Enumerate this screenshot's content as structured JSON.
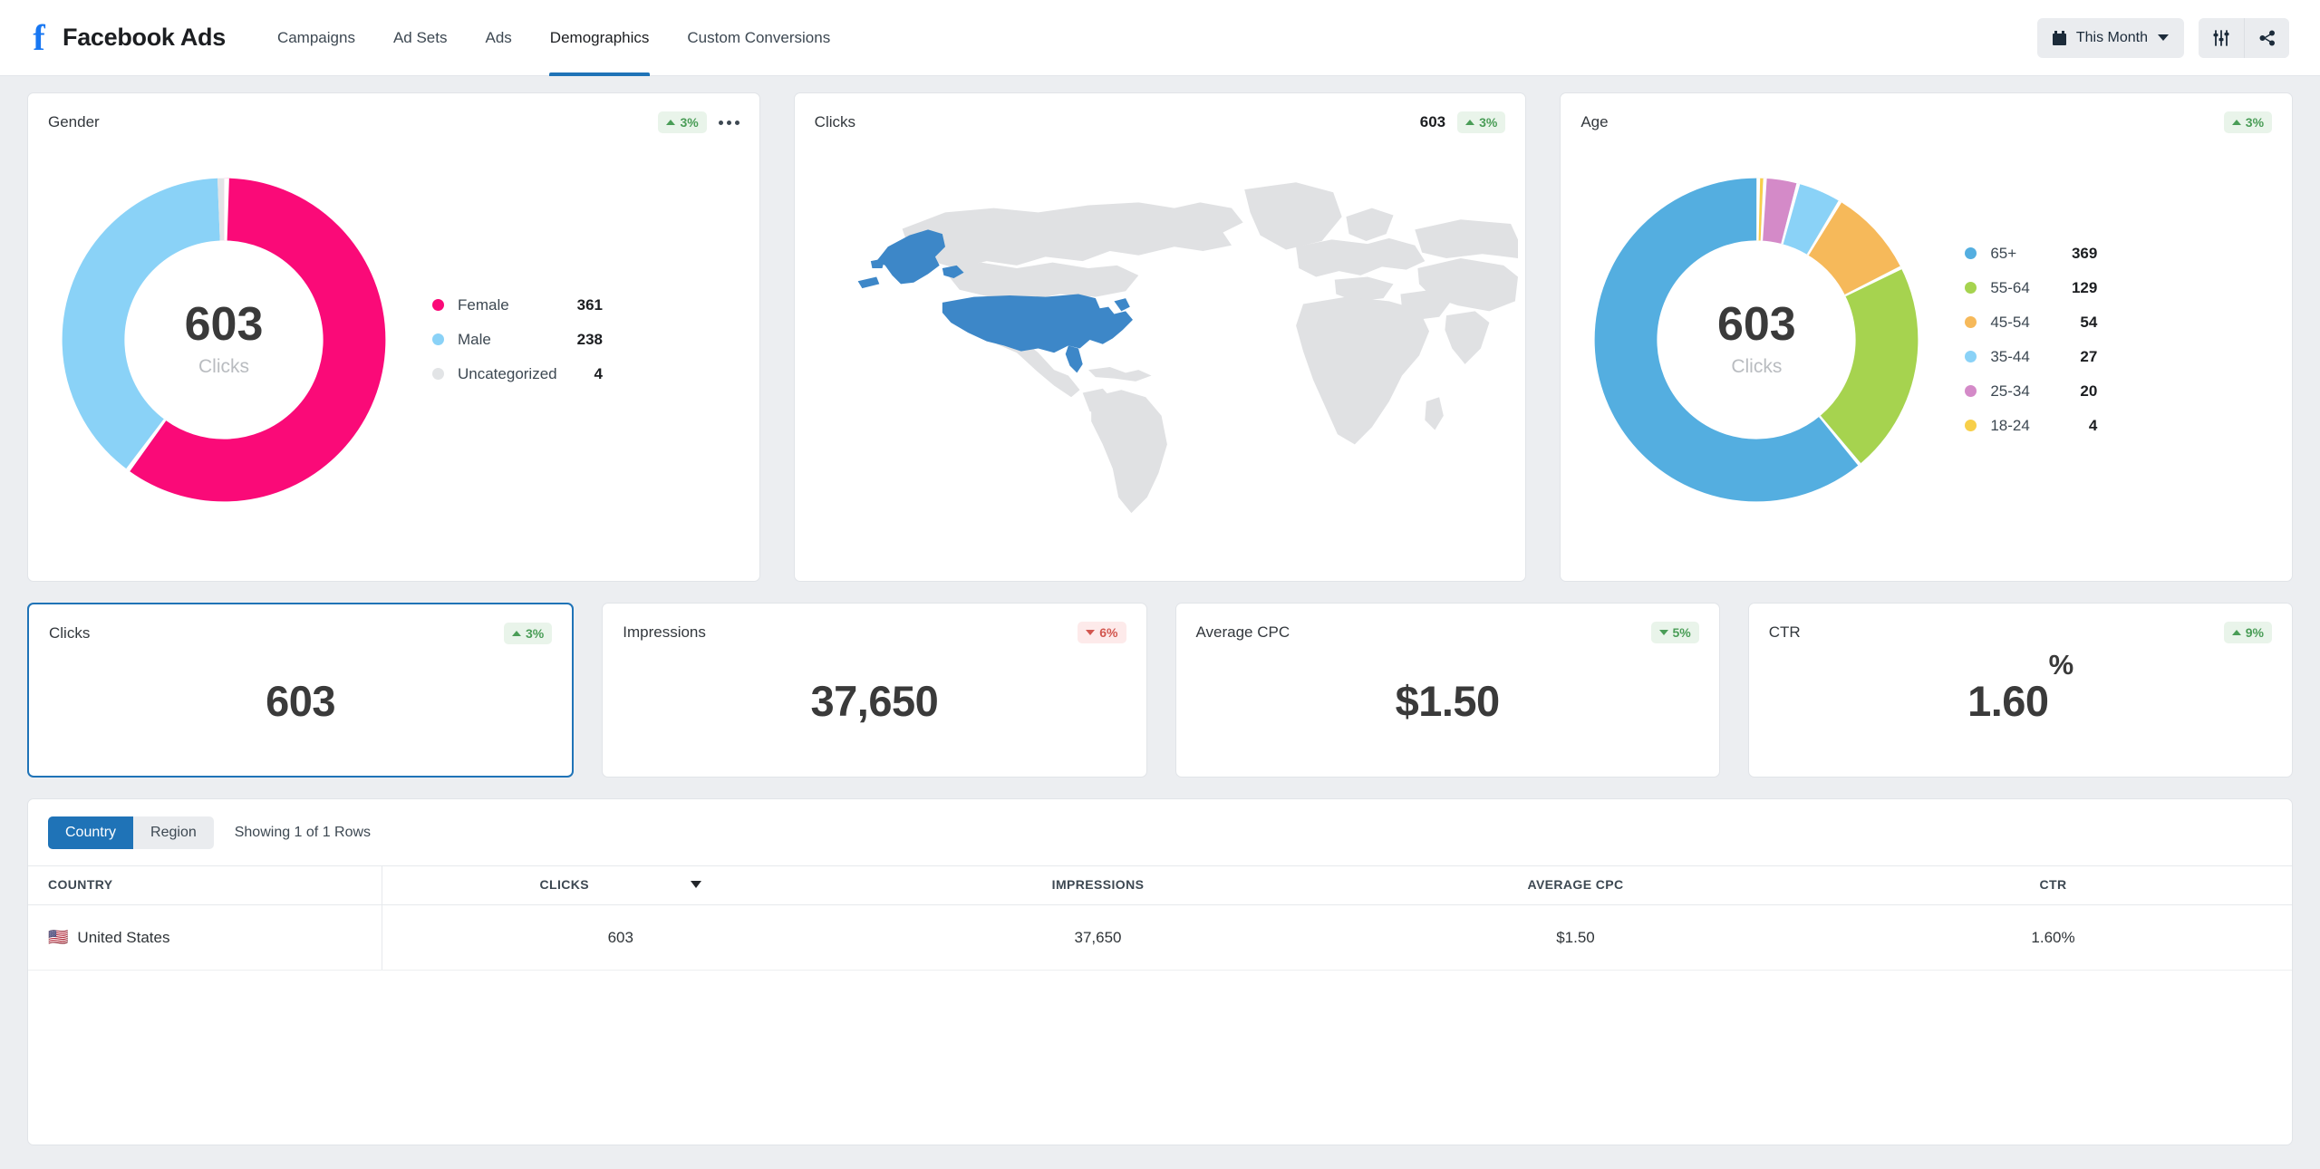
{
  "nav": {
    "brand": "Facebook Ads",
    "brand_icon": "facebook-f-icon",
    "links": [
      {
        "label": "Campaigns",
        "active": false
      },
      {
        "label": "Ad Sets",
        "active": false
      },
      {
        "label": "Ads",
        "active": false
      },
      {
        "label": "Demographics",
        "active": true
      },
      {
        "label": "Custom Conversions",
        "active": false
      }
    ],
    "date_filter": {
      "label": "This Month",
      "icon": "calendar-icon",
      "chevron": "chevron-down-icon"
    },
    "filter_icon": "sliders-icon",
    "share_icon": "share-icon",
    "accent": "#1f73b7"
  },
  "cards": {
    "gender": {
      "title": "Gender",
      "badge": {
        "value": "3%",
        "direction": "up"
      },
      "menu_icon": "more-options-icon",
      "center_value": "603",
      "center_label": "Clicks"
    },
    "map": {
      "title": "Clicks",
      "value": "603",
      "badge": {
        "value": "3%",
        "direction": "up"
      },
      "highlight_color": "#3d87c8",
      "land_color": "#e0e1e3"
    },
    "age": {
      "title": "Age",
      "badge": {
        "value": "3%",
        "direction": "up"
      },
      "center_value": "603",
      "center_label": "Clicks"
    }
  },
  "kpis": [
    {
      "title": "Clicks",
      "value": "603",
      "suffix": "",
      "badge": {
        "value": "3%",
        "direction": "up"
      },
      "selected": true
    },
    {
      "title": "Impressions",
      "value": "37,650",
      "suffix": "",
      "badge": {
        "value": "6%",
        "direction": "down"
      },
      "selected": false
    },
    {
      "title": "Average CPC",
      "value": "$1.50",
      "suffix": "",
      "badge": {
        "value": "5%",
        "direction": "down-good"
      },
      "selected": false
    },
    {
      "title": "CTR",
      "value": "1.60",
      "suffix": "%",
      "badge": {
        "value": "9%",
        "direction": "up"
      },
      "selected": false
    }
  ],
  "table": {
    "toggle": [
      {
        "label": "Country",
        "active": true
      },
      {
        "label": "Region",
        "active": false
      }
    ],
    "showing": "Showing 1 of 1 Rows",
    "columns": [
      "COUNTRY",
      "CLICKS",
      "IMPRESSIONS",
      "AVERAGE CPC",
      "CTR"
    ],
    "sorted_column": "CLICKS",
    "sort_direction": "desc",
    "rows": [
      {
        "flag": "🇺🇸",
        "country": "United States",
        "clicks": "603",
        "impressions": "37,650",
        "average_cpc": "$1.50",
        "ctr": "1.60%"
      }
    ]
  },
  "chart_data": [
    {
      "type": "pie",
      "title": "Gender",
      "center_value": 603,
      "center_label": "Clicks",
      "labels": [
        "Female",
        "Male",
        "Uncategorized"
      ],
      "values": [
        361,
        238,
        4
      ],
      "colors": [
        "#fa0a78",
        "#8ad2f7",
        "#e2e4e6"
      ],
      "legend_position": "right"
    },
    {
      "type": "pie",
      "title": "Age",
      "center_value": 603,
      "center_label": "Clicks",
      "labels": [
        "65+",
        "55-64",
        "45-54",
        "35-44",
        "25-34",
        "18-24"
      ],
      "values": [
        369,
        129,
        54,
        27,
        20,
        4
      ],
      "colors": [
        "#54aee0",
        "#a6d34f",
        "#f6b95a",
        "#8ad2f7",
        "#d48ac8",
        "#f7cf4a"
      ],
      "legend_position": "right"
    },
    {
      "type": "heatmap",
      "title": "Clicks",
      "subtitle": "World map choropleth",
      "labels": [
        "United States"
      ],
      "values": [
        603
      ]
    }
  ]
}
